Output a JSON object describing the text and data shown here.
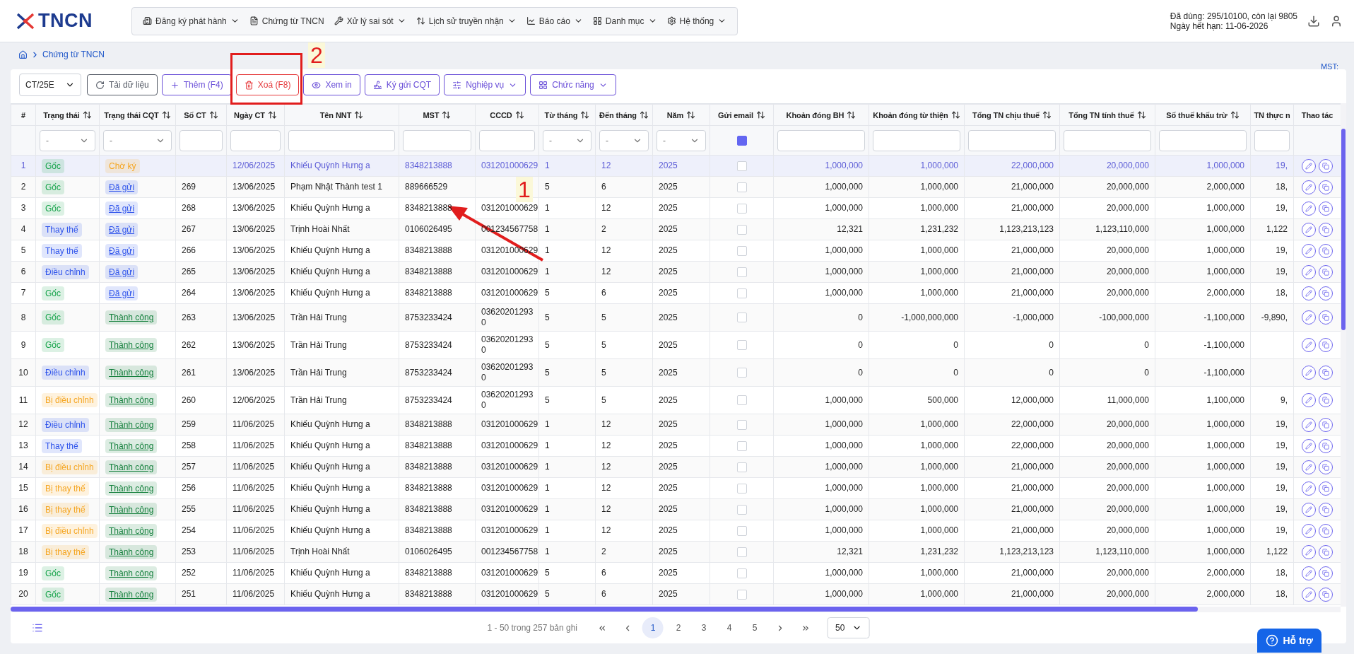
{
  "logo": "TNCN",
  "nav": [
    {
      "label": "Đăng ký phát hành",
      "dropdown": true
    },
    {
      "label": "Chứng từ TNCN",
      "dropdown": false
    },
    {
      "label": "Xử lý sai sót",
      "dropdown": true
    },
    {
      "label": "Lịch sử truyền nhận",
      "dropdown": true
    },
    {
      "label": "Báo cáo",
      "dropdown": true
    },
    {
      "label": "Danh mục",
      "dropdown": true
    },
    {
      "label": "Hệ thống",
      "dropdown": true
    }
  ],
  "usage": [
    "Đã dùng: 295/10100, còn lại 9805",
    "Ngày hết hạn: 11-06-2026"
  ],
  "breadcrumb": "Chứng từ TNCN",
  "mst_label": "MST:",
  "series_select": "CT/25E",
  "toolbar": [
    {
      "label": "Tải dữ liệu",
      "kind": "neutral",
      "dropdown": false
    },
    {
      "label": "Thêm (F4)",
      "kind": "primary",
      "dropdown": false
    },
    {
      "label": "Xoá (F8)",
      "kind": "danger",
      "dropdown": false
    },
    {
      "label": "Xem in",
      "kind": "primary",
      "dropdown": false
    },
    {
      "label": "Ký gửi CQT",
      "kind": "primary",
      "dropdown": false
    },
    {
      "label": "Nghiệp vụ",
      "kind": "primary",
      "dropdown": true
    },
    {
      "label": "Chức năng",
      "kind": "primary",
      "dropdown": true
    }
  ],
  "columns": [
    {
      "label": "#",
      "kind": "index",
      "sortable": false
    },
    {
      "label": "Trạng thái",
      "kind": "status",
      "sortable": true
    },
    {
      "label": "Trạng thái CQT",
      "kind": "cqt",
      "sortable": true
    },
    {
      "label": "Số CT",
      "kind": "text",
      "sortable": true
    },
    {
      "label": "Ngày CT",
      "kind": "text",
      "sortable": true
    },
    {
      "label": "Tên NNT",
      "kind": "text",
      "sortable": true
    },
    {
      "label": "MST",
      "kind": "text",
      "sortable": true
    },
    {
      "label": "CCCD",
      "kind": "text",
      "sortable": true
    },
    {
      "label": "Từ tháng",
      "kind": "text",
      "sortable": true
    },
    {
      "label": "Đến tháng",
      "kind": "text",
      "sortable": true
    },
    {
      "label": "Năm",
      "kind": "text",
      "sortable": true
    },
    {
      "label": "Gửi email",
      "kind": "check",
      "sortable": true
    },
    {
      "label": "Khoản đóng BH",
      "kind": "num",
      "sortable": true
    },
    {
      "label": "Khoản đóng từ thiện",
      "kind": "num",
      "sortable": true
    },
    {
      "label": "Tổng TN chịu thuế",
      "kind": "num",
      "sortable": true
    },
    {
      "label": "Tổng TN tính thuế",
      "kind": "num",
      "sortable": true
    },
    {
      "label": "Số thuế khấu trừ",
      "kind": "num",
      "sortable": true
    },
    {
      "label": "TN thực n",
      "kind": "num",
      "sortable": false
    },
    {
      "label": "Thao tác",
      "kind": "actions",
      "sortable": false
    }
  ],
  "filters": [
    {
      "kind": "none"
    },
    {
      "kind": "select",
      "value": "-"
    },
    {
      "kind": "select",
      "value": "-"
    },
    {
      "kind": "input"
    },
    {
      "kind": "input"
    },
    {
      "kind": "input"
    },
    {
      "kind": "input"
    },
    {
      "kind": "input"
    },
    {
      "kind": "select",
      "value": "-"
    },
    {
      "kind": "select",
      "value": "-"
    },
    {
      "kind": "select",
      "value": "-"
    },
    {
      "kind": "checkbox",
      "checked": true
    },
    {
      "kind": "input"
    },
    {
      "kind": "input"
    },
    {
      "kind": "input"
    },
    {
      "kind": "input"
    },
    {
      "kind": "input"
    },
    {
      "kind": "input"
    },
    {
      "kind": "none"
    }
  ],
  "rows": [
    {
      "selected": true,
      "cells": [
        "1",
        {
          "text": "Gốc",
          "color": "#16a34a"
        },
        {
          "text": "Chờ ký",
          "color": "#f5a623",
          "link": false
        },
        null,
        "12/06/2025",
        "Khiếu Quỳnh Hưng a",
        "8348213888",
        "031201000629",
        "1",
        "12",
        "2025",
        {
          "checked": false
        },
        "1,000,000",
        "1,000,000",
        "22,000,000",
        "20,000,000",
        "1,000,000",
        "19,"
      ]
    },
    {
      "selected": false,
      "cells": [
        "2",
        {
          "text": "Gốc",
          "color": "#16a34a"
        },
        {
          "text": "Đã gửi",
          "color": "#2f54eb",
          "link": true
        },
        "269",
        "13/06/2025",
        "Phạm Nhật Thành test 1",
        "889666529",
        null,
        "5",
        "6",
        "2025",
        {
          "checked": false
        },
        "1,000,000",
        "1,000,000",
        "21,000,000",
        "20,000,000",
        "2,000,000",
        "18,"
      ]
    },
    {
      "selected": false,
      "cells": [
        "3",
        {
          "text": "Gốc",
          "color": "#16a34a"
        },
        {
          "text": "Đã gửi",
          "color": "#2f54eb",
          "link": true
        },
        "268",
        "13/06/2025",
        "Khiếu Quỳnh Hưng a",
        "8348213888",
        "031201000629",
        "1",
        "12",
        "2025",
        {
          "checked": false
        },
        "1,000,000",
        "1,000,000",
        "21,000,000",
        "20,000,000",
        "1,000,000",
        "19,"
      ]
    },
    {
      "selected": false,
      "cells": [
        "4",
        {
          "text": "Thay thế",
          "color": "#2f54eb"
        },
        {
          "text": "Đã gửi",
          "color": "#2f54eb",
          "link": true
        },
        "267",
        "13/06/2025",
        "Trịnh Hoài Nhất",
        "0106026495",
        "001234567758",
        "1",
        "2",
        "2025",
        {
          "checked": false
        },
        "12,321",
        "1,231,232",
        "1,123,213,123",
        "1,123,110,000",
        "1,000,000",
        "1,122"
      ]
    },
    {
      "selected": false,
      "cells": [
        "5",
        {
          "text": "Thay thế",
          "color": "#2f54eb"
        },
        {
          "text": "Đã gửi",
          "color": "#2f54eb",
          "link": true
        },
        "266",
        "13/06/2025",
        "Khiếu Quỳnh Hưng a",
        "8348213888",
        "031201000629",
        "1",
        "12",
        "2025",
        {
          "checked": false
        },
        "1,000,000",
        "1,000,000",
        "21,000,000",
        "20,000,000",
        "1,000,000",
        "19,"
      ]
    },
    {
      "selected": false,
      "cells": [
        "6",
        {
          "text": "Điều chỉnh",
          "color": "#2f54eb"
        },
        {
          "text": "Đã gửi",
          "color": "#2f54eb",
          "link": true
        },
        "265",
        "13/06/2025",
        "Khiếu Quỳnh Hưng a",
        "8348213888",
        "031201000629",
        "1",
        "12",
        "2025",
        {
          "checked": false
        },
        "1,000,000",
        "1,000,000",
        "21,000,000",
        "20,000,000",
        "1,000,000",
        "19,"
      ]
    },
    {
      "selected": false,
      "cells": [
        "7",
        {
          "text": "Gốc",
          "color": "#16a34a"
        },
        {
          "text": "Đã gửi",
          "color": "#2f54eb",
          "link": true
        },
        "264",
        "13/06/2025",
        "Khiếu Quỳnh Hưng a",
        "8348213888",
        "031201000629",
        "5",
        "6",
        "2025",
        {
          "checked": false
        },
        "1,000,000",
        "1,000,000",
        "21,000,000",
        "20,000,000",
        "2,000,000",
        "18,"
      ]
    },
    {
      "selected": false,
      "cells": [
        "8",
        {
          "text": "Gốc",
          "color": "#16a34a"
        },
        {
          "text": "Thành công",
          "color": "#15803d",
          "link": true
        },
        "263",
        "13/06/2025",
        "Trần Hải Trung",
        "8753233424",
        "03620201293\n0",
        "5",
        "5",
        "2025",
        {
          "checked": false
        },
        "0",
        "-1,000,000,000",
        "-1,000,000",
        "-100,000,000",
        "-1,100,000",
        "-9,890,"
      ]
    },
    {
      "selected": false,
      "cells": [
        "9",
        {
          "text": "Gốc",
          "color": "#16a34a"
        },
        {
          "text": "Thành công",
          "color": "#15803d",
          "link": true
        },
        "262",
        "13/06/2025",
        "Trần Hải Trung",
        "8753233424",
        "03620201293\n0",
        "5",
        "5",
        "2025",
        {
          "checked": false
        },
        "0",
        "0",
        "0",
        "0",
        "-1,100,000",
        null
      ]
    },
    {
      "selected": false,
      "cells": [
        "10",
        {
          "text": "Điều chỉnh",
          "color": "#2f54eb"
        },
        {
          "text": "Thành công",
          "color": "#15803d",
          "link": true
        },
        "261",
        "13/06/2025",
        "Trần Hải Trung",
        "8753233424",
        "03620201293\n0",
        "5",
        "5",
        "2025",
        {
          "checked": false
        },
        "0",
        "0",
        "0",
        "0",
        "-1,100,000",
        null
      ]
    },
    {
      "selected": false,
      "cells": [
        "11",
        {
          "text": "Bị điều chỉnh",
          "color": "#f5a623"
        },
        {
          "text": "Thành công",
          "color": "#15803d",
          "link": true
        },
        "260",
        "12/06/2025",
        "Trần Hải Trung",
        "8753233424",
        "03620201293\n0",
        "5",
        "5",
        "2025",
        {
          "checked": false
        },
        "1,000,000",
        "500,000",
        "12,000,000",
        "11,000,000",
        "1,100,000",
        "9,"
      ]
    },
    {
      "selected": false,
      "cells": [
        "12",
        {
          "text": "Điều chỉnh",
          "color": "#2f54eb"
        },
        {
          "text": "Thành công",
          "color": "#15803d",
          "link": true
        },
        "259",
        "11/06/2025",
        "Khiếu Quỳnh Hưng a",
        "8348213888",
        "031201000629",
        "1",
        "12",
        "2025",
        {
          "checked": false
        },
        "1,000,000",
        "1,000,000",
        "22,000,000",
        "20,000,000",
        "1,000,000",
        "19,"
      ]
    },
    {
      "selected": false,
      "cells": [
        "13",
        {
          "text": "Thay thế",
          "color": "#2f54eb"
        },
        {
          "text": "Thành công",
          "color": "#15803d",
          "link": true
        },
        "258",
        "11/06/2025",
        "Khiếu Quỳnh Hưng a",
        "8348213888",
        "031201000629",
        "1",
        "12",
        "2025",
        {
          "checked": false
        },
        "1,000,000",
        "1,000,000",
        "22,000,000",
        "20,000,000",
        "1,000,000",
        "19,"
      ]
    },
    {
      "selected": false,
      "cells": [
        "14",
        {
          "text": "Bị điều chỉnh",
          "color": "#f5a623"
        },
        {
          "text": "Thành công",
          "color": "#15803d",
          "link": true
        },
        "257",
        "11/06/2025",
        "Khiếu Quỳnh Hưng a",
        "8348213888",
        "031201000629",
        "1",
        "12",
        "2025",
        {
          "checked": false
        },
        "1,000,000",
        "1,000,000",
        "21,000,000",
        "20,000,000",
        "1,000,000",
        "19,"
      ]
    },
    {
      "selected": false,
      "cells": [
        "15",
        {
          "text": "Bị thay thế",
          "color": "#f5a623"
        },
        {
          "text": "Thành công",
          "color": "#15803d",
          "link": true
        },
        "256",
        "11/06/2025",
        "Khiếu Quỳnh Hưng a",
        "8348213888",
        "031201000629",
        "1",
        "12",
        "2025",
        {
          "checked": false
        },
        "1,000,000",
        "1,000,000",
        "21,000,000",
        "20,000,000",
        "1,000,000",
        "19,"
      ]
    },
    {
      "selected": false,
      "cells": [
        "16",
        {
          "text": "Bị thay thế",
          "color": "#f5a623"
        },
        {
          "text": "Thành công",
          "color": "#15803d",
          "link": true
        },
        "255",
        "11/06/2025",
        "Khiếu Quỳnh Hưng a",
        "8348213888",
        "031201000629",
        "1",
        "12",
        "2025",
        {
          "checked": false
        },
        "1,000,000",
        "1,000,000",
        "21,000,000",
        "20,000,000",
        "1,000,000",
        "19,"
      ]
    },
    {
      "selected": false,
      "cells": [
        "17",
        {
          "text": "Bị điều chỉnh",
          "color": "#f5a623"
        },
        {
          "text": "Thành công",
          "color": "#15803d",
          "link": true
        },
        "254",
        "11/06/2025",
        "Khiếu Quỳnh Hưng a",
        "8348213888",
        "031201000629",
        "1",
        "12",
        "2025",
        {
          "checked": false
        },
        "1,000,000",
        "1,000,000",
        "21,000,000",
        "20,000,000",
        "1,000,000",
        "19,"
      ]
    },
    {
      "selected": false,
      "cells": [
        "18",
        {
          "text": "Bị thay thế",
          "color": "#f5a623"
        },
        {
          "text": "Thành công",
          "color": "#15803d",
          "link": true
        },
        "253",
        "11/06/2025",
        "Trịnh Hoài Nhất",
        "0106026495",
        "001234567758",
        "1",
        "2",
        "2025",
        {
          "checked": false
        },
        "12,321",
        "1,231,232",
        "1,123,213,123",
        "1,123,110,000",
        "1,000,000",
        "1,122"
      ]
    },
    {
      "selected": false,
      "cells": [
        "19",
        {
          "text": "Gốc",
          "color": "#16a34a"
        },
        {
          "text": "Thành công",
          "color": "#15803d",
          "link": true
        },
        "252",
        "11/06/2025",
        "Khiếu Quỳnh Hưng a",
        "8348213888",
        "031201000629",
        "5",
        "6",
        "2025",
        {
          "checked": false
        },
        "1,000,000",
        "1,000,000",
        "21,000,000",
        "20,000,000",
        "2,000,000",
        "18,"
      ]
    },
    {
      "selected": false,
      "cells": [
        "20",
        {
          "text": "Gốc",
          "color": "#16a34a"
        },
        {
          "text": "Thành công",
          "color": "#15803d",
          "link": true
        },
        "251",
        "11/06/2025",
        "Khiếu Quỳnh Hưng a",
        "8348213888",
        "031201000629",
        "5",
        "6",
        "2025",
        {
          "checked": false
        },
        "1,000,000",
        "1,000,000",
        "21,000,000",
        "20,000,000",
        "2,000,000",
        "18,"
      ]
    }
  ],
  "pagination": {
    "summary": "1 - 50 trong 257 bản ghi",
    "pages": [
      {
        "label": "1",
        "selected": true
      },
      {
        "label": "2",
        "selected": false
      },
      {
        "label": "3",
        "selected": false
      },
      {
        "label": "4",
        "selected": false
      },
      {
        "label": "5",
        "selected": false
      }
    ],
    "page_size": "50"
  },
  "help_button": "Hỗ trợ",
  "annotations": [
    {
      "kind": "box",
      "label": "2"
    },
    {
      "kind": "arrow",
      "label": "1"
    }
  ]
}
